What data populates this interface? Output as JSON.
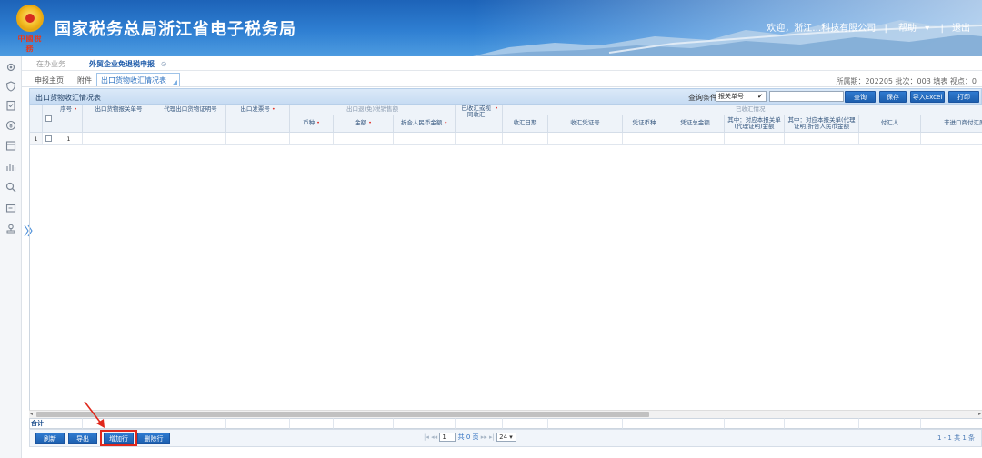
{
  "header": {
    "site_title": "国家税务总局浙江省电子税务局",
    "emblem_seal": "中國稅務",
    "welcome": "欢迎，浙江…科技有限公司",
    "sep1": "|",
    "help": "帮助",
    "help_arrow": "▾",
    "sep2": "|",
    "exit": "退出"
  },
  "sidebar": {
    "icons": [
      "gear-icon",
      "shield-icon",
      "clipboard-icon",
      "coin-icon",
      "calendar-icon",
      "chart-icon",
      "search-icon",
      "card-icon",
      "stamp-icon"
    ]
  },
  "tabs_level1": {
    "pending": "在办业务",
    "active": "外贸企业免退税申报",
    "active_close": "⊙"
  },
  "tabs_level2": {
    "home": "申报主页",
    "attachment": "附件",
    "active": "出口货物收汇情况表"
  },
  "period_info": "所属期：202205  批次：003  填表  视点：0",
  "toolbar": {
    "title": "出口货物收汇情况表",
    "query_label": "查询条件",
    "query_option": "报关单号",
    "query_arrow": "✔",
    "query_button": "查询",
    "save_button": "保存",
    "import_button": "导入Excel",
    "print_button": "打印"
  },
  "grid": {
    "headers": {
      "seq": "序号",
      "customs_no": "出口货物报关单号",
      "agent_cert": "代理出口货物证明号",
      "invoice_no": "出口发票号",
      "group_sales": "出口退(免)税销售额",
      "currency": "币种",
      "amount": "金额",
      "rmb_amount": "折合人民币金额",
      "received_flag": "已收汇或视同收汇",
      "group_received": "已收汇情况",
      "receipt_date": "收汇日期",
      "voucher_no": "收汇凭证号",
      "voucher_currency": "凭证币种",
      "voucher_total": "凭证总金额",
      "matched_amount": "其中：对应本报关单(代理证明)金额",
      "matched_rmb": "其中：对应本报关单(代理证明)折合人民币金额",
      "payer": "付汇人",
      "non_payer_reason": "非进口商付汇原因"
    },
    "rows": [
      {
        "row_no": "1",
        "seq": "1"
      }
    ],
    "total_label": "合计"
  },
  "bottom": {
    "refresh": "刷新",
    "export": "导出",
    "add_row": "增加行",
    "delete_row": "删除行",
    "pager_first": "|◂",
    "pager_prev": "◂◂",
    "page_value": "1",
    "page_total": "共 0 页",
    "pager_next": "▸▸",
    "pager_last": "▸|",
    "page_size": "24",
    "page_size_arrow": "▾",
    "range": "1 - 1  共 1 条"
  }
}
